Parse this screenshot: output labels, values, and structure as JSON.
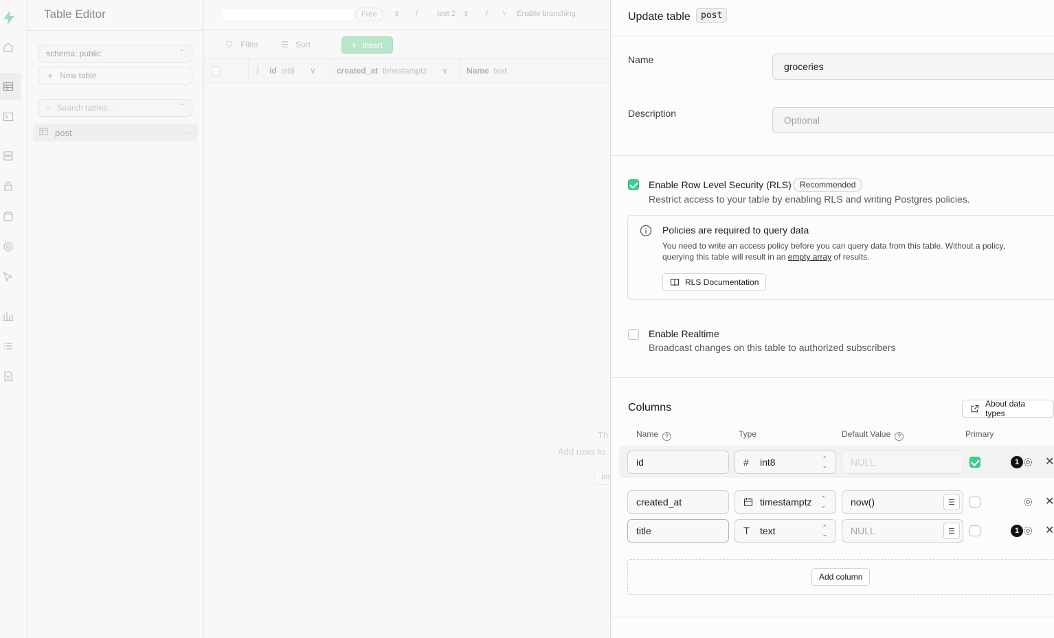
{
  "sidebar": {
    "title": "Table Editor",
    "schema": "schema: public",
    "new_table": "New table",
    "search_placeholder": "Search tables...",
    "tables": [
      "post"
    ]
  },
  "topbar": {
    "plan": "Free",
    "branch": "test 2",
    "enable_branching": "Enable branching"
  },
  "toolbar": {
    "filter": "Filter",
    "sort": "Sort",
    "insert": "Insert"
  },
  "grid": {
    "columns": [
      {
        "name": "id",
        "type": "int8"
      },
      {
        "name": "created_at",
        "type": "timestamptz"
      },
      {
        "name": "Name",
        "type": "text"
      }
    ],
    "empty_line1": "Th",
    "empty_line2": "Add rows to",
    "empty_btn": "Im"
  },
  "panel": {
    "title": "Update table",
    "table_code": "post",
    "name_label": "Name",
    "name_value": "groceries",
    "description_label": "Description",
    "description_placeholder": "Optional",
    "rls": {
      "checked": true,
      "label": "Enable Row Level Security (RLS)",
      "badge": "Recommended",
      "desc": "Restrict access to your table by enabling RLS and writing Postgres policies."
    },
    "policy_box": {
      "title": "Policies are required to query data",
      "body_pre": "You need to write an access policy before you can query data from this table. Without a policy, querying this table will result in an ",
      "body_link": "empty array",
      "body_post": " of results.",
      "button": "RLS Documentation"
    },
    "realtime": {
      "checked": false,
      "label": "Enable Realtime",
      "desc": "Broadcast changes on this table to authorized subscribers"
    },
    "columns_title": "Columns",
    "about_types": "About data types",
    "col_headers": {
      "name": "Name",
      "type": "Type",
      "default": "Default Value",
      "primary": "Primary"
    },
    "columns": [
      {
        "name": "id",
        "type_icon": "#",
        "type": "int8",
        "default": "NULL",
        "primary": true,
        "badge": "1"
      },
      {
        "name": "created_at",
        "type_icon": "calendar",
        "type": "timestamptz",
        "default": "now()",
        "primary": false,
        "badge": ""
      },
      {
        "name": "title",
        "type_icon": "T",
        "type": "text",
        "default": "NULL",
        "primary": false,
        "badge": "1"
      }
    ],
    "add_column": "Add column"
  }
}
